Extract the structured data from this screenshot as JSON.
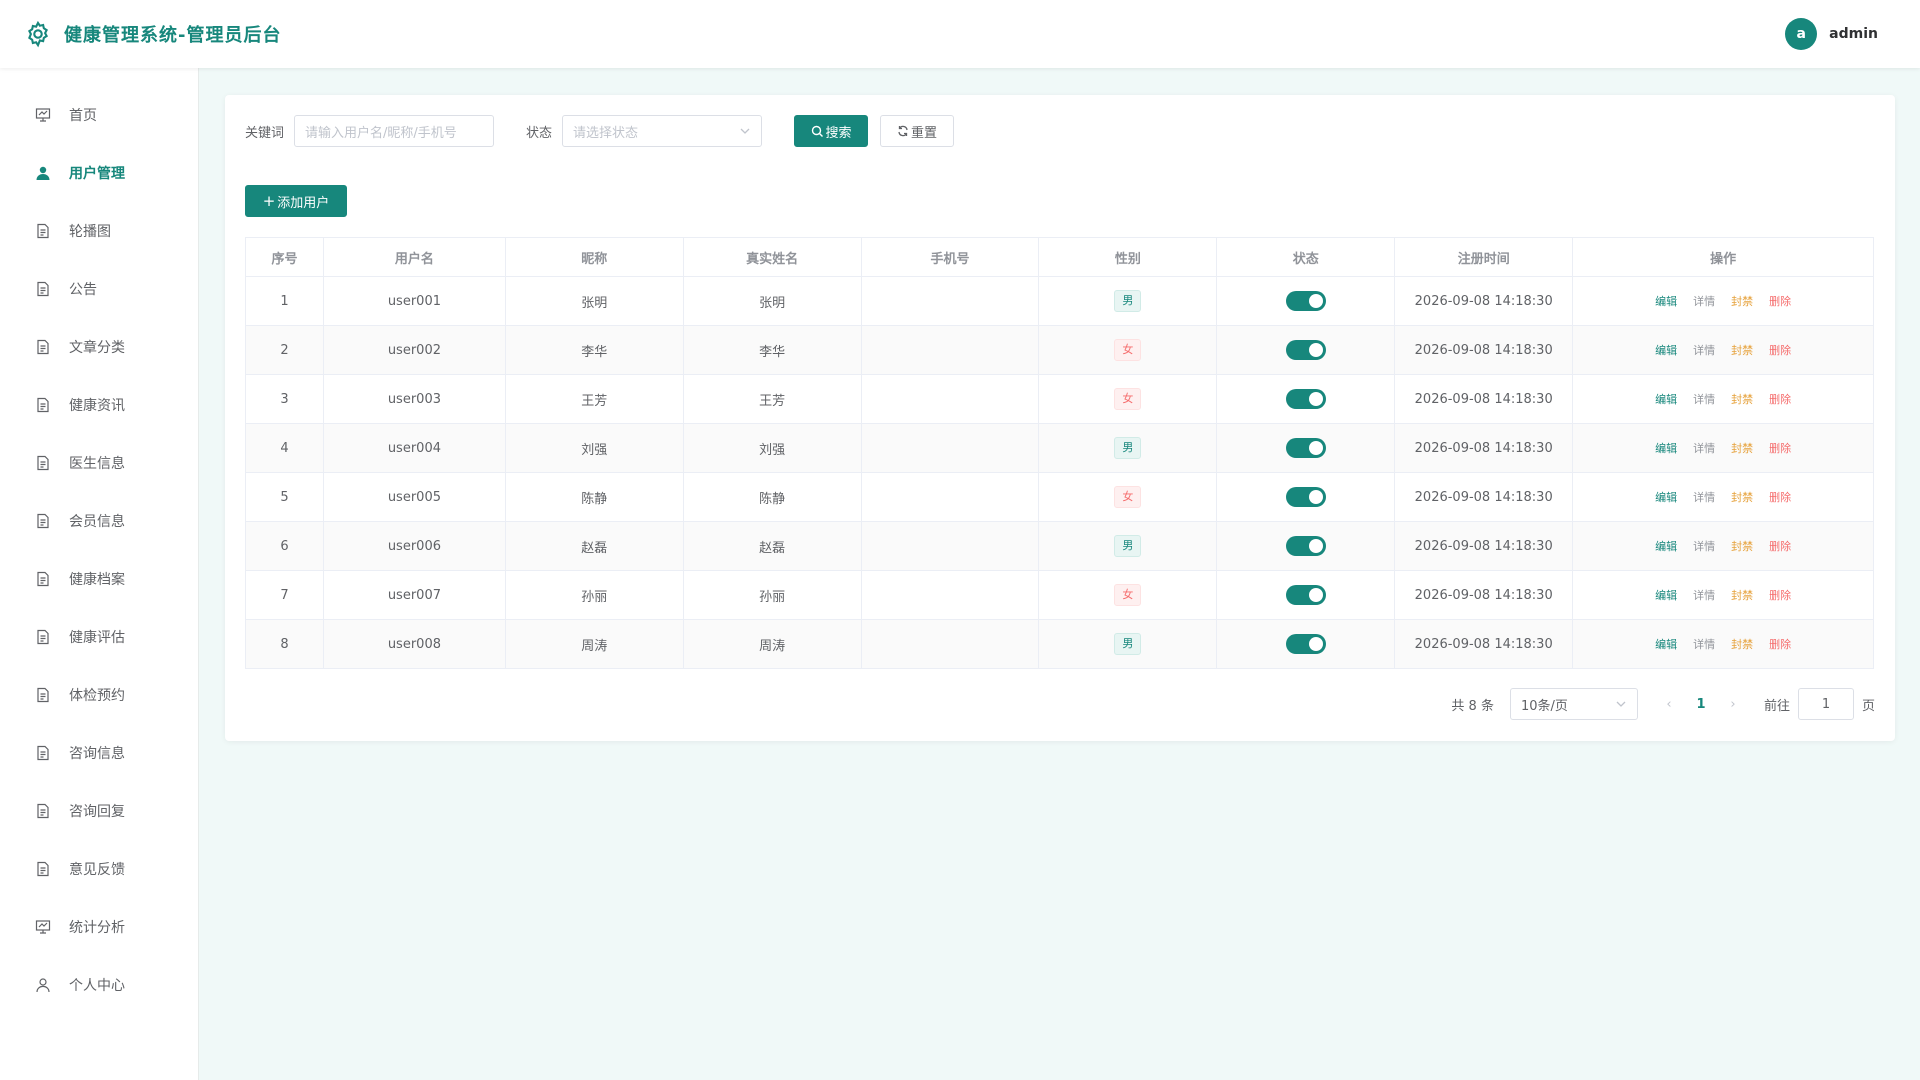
{
  "header": {
    "title": "健康管理系统-管理员后台",
    "avatar_letter": "a",
    "user_name": "admin"
  },
  "sidebar": {
    "items": [
      {
        "label": "首页",
        "icon": "dashboard-icon"
      },
      {
        "label": "用户管理",
        "icon": "user-icon",
        "active": true
      },
      {
        "label": "轮播图",
        "icon": "document-icon"
      },
      {
        "label": "公告",
        "icon": "document-icon"
      },
      {
        "label": "文章分类",
        "icon": "document-icon"
      },
      {
        "label": "健康资讯",
        "icon": "document-icon"
      },
      {
        "label": "医生信息",
        "icon": "document-icon"
      },
      {
        "label": "会员信息",
        "icon": "document-icon"
      },
      {
        "label": "健康档案",
        "icon": "document-icon"
      },
      {
        "label": "健康评估",
        "icon": "document-icon"
      },
      {
        "label": "体检预约",
        "icon": "document-icon"
      },
      {
        "label": "咨询信息",
        "icon": "document-icon"
      },
      {
        "label": "咨询回复",
        "icon": "document-icon"
      },
      {
        "label": "意见反馈",
        "icon": "document-icon"
      },
      {
        "label": "统计分析",
        "icon": "chart-icon"
      },
      {
        "label": "个人中心",
        "icon": "person-icon"
      }
    ]
  },
  "filter": {
    "keyword_label": "关键词",
    "keyword_placeholder": "请输入用户名/昵称/手机号",
    "status_label": "状态",
    "status_placeholder": "请选择状态",
    "search_label": "搜索",
    "reset_label": "重置"
  },
  "toolbar": {
    "add_label": "添加用户"
  },
  "table": {
    "headers": [
      "序号",
      "用户名",
      "昵称",
      "真实姓名",
      "手机号",
      "性别",
      "状态",
      "注册时间",
      "操作"
    ],
    "actions": {
      "edit": "编辑",
      "detail": "详情",
      "ban": "封禁",
      "delete": "删除"
    },
    "rows": [
      {
        "index": "1",
        "username": "user001",
        "nickname": "张明",
        "realname": "张明",
        "phone": "",
        "gender": "男",
        "enabled": true,
        "created": "2026-09-08 14:18:30"
      },
      {
        "index": "2",
        "username": "user002",
        "nickname": "李华",
        "realname": "李华",
        "phone": "",
        "gender": "女",
        "enabled": true,
        "created": "2026-09-08 14:18:30"
      },
      {
        "index": "3",
        "username": "user003",
        "nickname": "王芳",
        "realname": "王芳",
        "phone": "",
        "gender": "女",
        "enabled": true,
        "created": "2026-09-08 14:18:30"
      },
      {
        "index": "4",
        "username": "user004",
        "nickname": "刘强",
        "realname": "刘强",
        "phone": "",
        "gender": "男",
        "enabled": true,
        "created": "2026-09-08 14:18:30"
      },
      {
        "index": "5",
        "username": "user005",
        "nickname": "陈静",
        "realname": "陈静",
        "phone": "",
        "gender": "女",
        "enabled": true,
        "created": "2026-09-08 14:18:30"
      },
      {
        "index": "6",
        "username": "user006",
        "nickname": "赵磊",
        "realname": "赵磊",
        "phone": "",
        "gender": "男",
        "enabled": true,
        "created": "2026-09-08 14:18:30"
      },
      {
        "index": "7",
        "username": "user007",
        "nickname": "孙丽",
        "realname": "孙丽",
        "phone": "",
        "gender": "女",
        "enabled": true,
        "created": "2026-09-08 14:18:30"
      },
      {
        "index": "8",
        "username": "user008",
        "nickname": "周涛",
        "realname": "周涛",
        "phone": "",
        "gender": "男",
        "enabled": true,
        "created": "2026-09-08 14:18:30"
      }
    ]
  },
  "pagination": {
    "total_text": "共 8 条",
    "page_size": "10条/页",
    "current_page": "1",
    "goto_label": "前往",
    "goto_value": "1",
    "page_suffix": "页"
  },
  "colors": {
    "accent": "#17877c",
    "male_tag": "#17877c",
    "female_tag": "#f56c6c",
    "ban": "#e6a23c",
    "delete": "#f56c6c"
  }
}
